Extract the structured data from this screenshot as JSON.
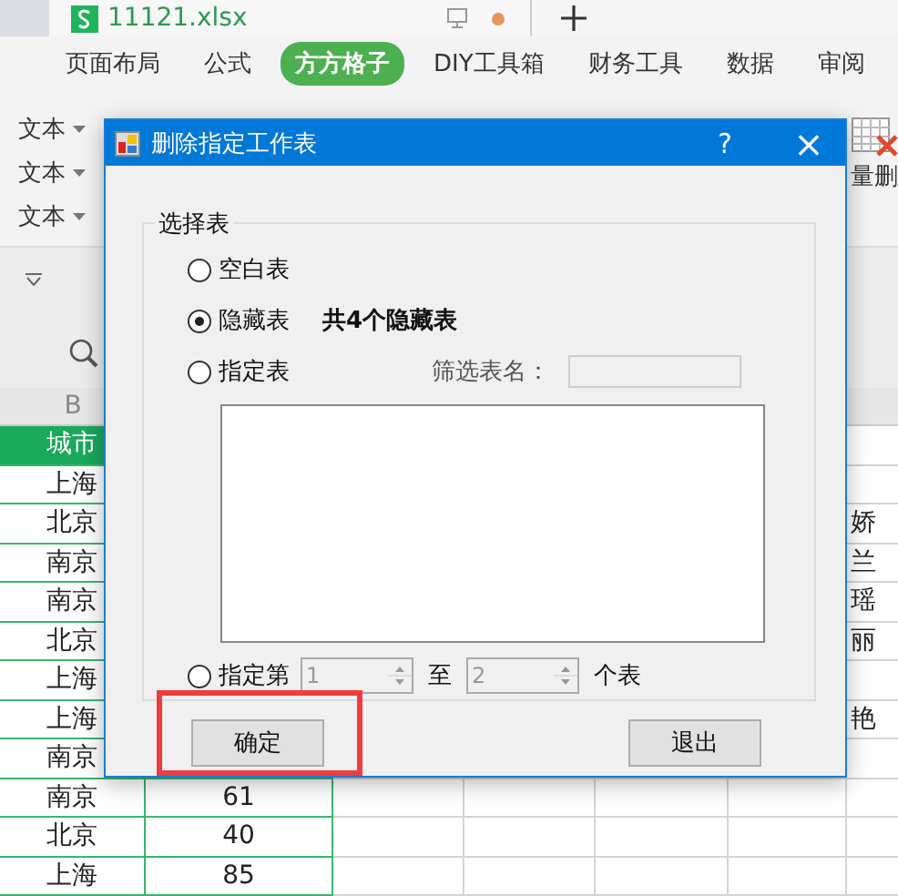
{
  "file_tab": {
    "title": "11121.xlsx"
  },
  "ribbon_tabs": [
    {
      "label": "页面布局",
      "selected": false
    },
    {
      "label": "公式",
      "selected": false
    },
    {
      "label": "方方格子",
      "selected": true
    },
    {
      "label": "DIY工具箱",
      "selected": false
    },
    {
      "label": "财务工具",
      "selected": false
    },
    {
      "label": "数据",
      "selected": false
    },
    {
      "label": "审阅",
      "selected": false
    }
  ],
  "ribbon_tools": [
    {
      "label": "文本"
    },
    {
      "label": "文本"
    },
    {
      "label": "文本"
    }
  ],
  "ribbon_right_label": "量删",
  "column_header": "B",
  "rows": [
    {
      "kind": "header",
      "city": "城市"
    },
    {
      "kind": "data",
      "city": "上海"
    },
    {
      "kind": "data",
      "city": "北京",
      "extra": "娇"
    },
    {
      "kind": "data",
      "city": "南京",
      "extra": "兰"
    },
    {
      "kind": "data",
      "city": "南京",
      "extra": "瑶"
    },
    {
      "kind": "data",
      "city": "北京",
      "extra": "丽"
    },
    {
      "kind": "data",
      "city": "上海"
    },
    {
      "kind": "data",
      "city": "上海",
      "extra": "艳"
    },
    {
      "kind": "data",
      "city": "南京"
    },
    {
      "kind": "data",
      "city": "南京",
      "value": "61"
    },
    {
      "kind": "data",
      "city": "北京",
      "value": "40"
    },
    {
      "kind": "data",
      "city": "上海",
      "value": "85"
    }
  ],
  "dialog": {
    "title": "删除指定工作表",
    "help": "?",
    "close": "×",
    "group_label": "选择表",
    "options": [
      {
        "label": "空白表",
        "selected": false
      },
      {
        "label": "隐藏表",
        "selected": true
      },
      {
        "label": "指定表",
        "selected": false
      }
    ],
    "hidden_count": "共4个隐藏表",
    "filter_label": "筛选表名：",
    "range": {
      "label": "指定第",
      "selected": false,
      "from": "1",
      "to_label": "至",
      "to": "2",
      "suffix": "个表",
      "disabled": true
    },
    "buttons": [
      {
        "label": "确定",
        "highlighted": true
      },
      {
        "label": "退出",
        "highlighted": false
      }
    ]
  }
}
